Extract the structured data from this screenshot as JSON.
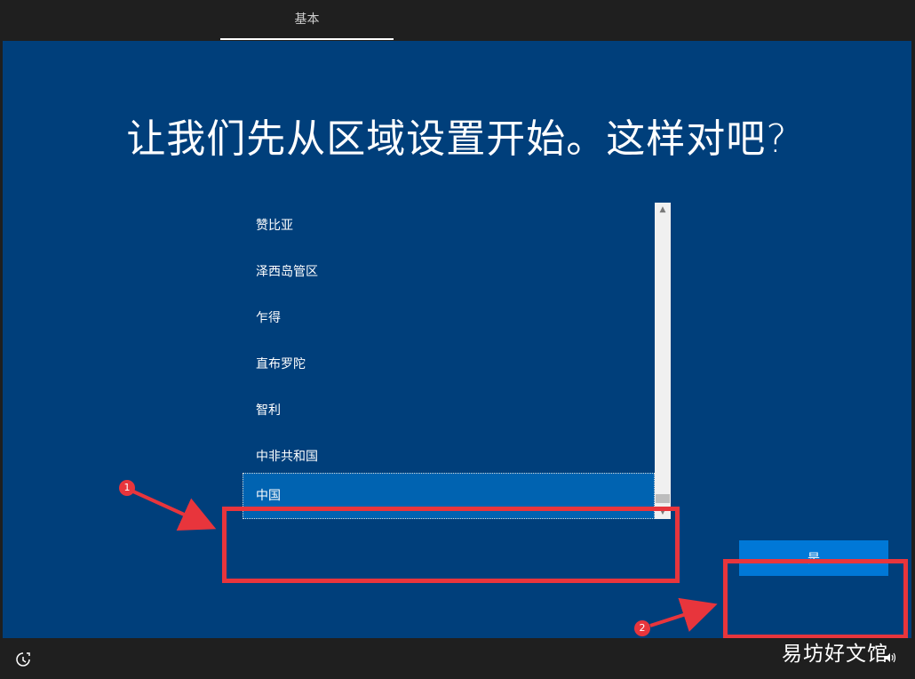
{
  "header": {
    "tab_label": "基本"
  },
  "main": {
    "heading": "让我们先从区域设置开始。这样对吧?",
    "region_list": [
      "赞比亚",
      "泽西岛管区",
      "乍得",
      "直布罗陀",
      "智利",
      "中非共和国",
      "中国"
    ],
    "selected_region": "中国",
    "yes_button_label": "是"
  },
  "annotations": {
    "marker_1": "1",
    "marker_2": "2"
  },
  "footer": {
    "ease_of_access_icon": "ease-of-access-icon",
    "volume_icon": "volume-icon"
  },
  "watermark": "易坊好文馆",
  "colors": {
    "background_blue": "#003f7b",
    "selected_blue": "#0063b1",
    "button_blue": "#0078d7",
    "annotation_red": "#e8353c",
    "bar_dark": "#1f1f1f"
  }
}
